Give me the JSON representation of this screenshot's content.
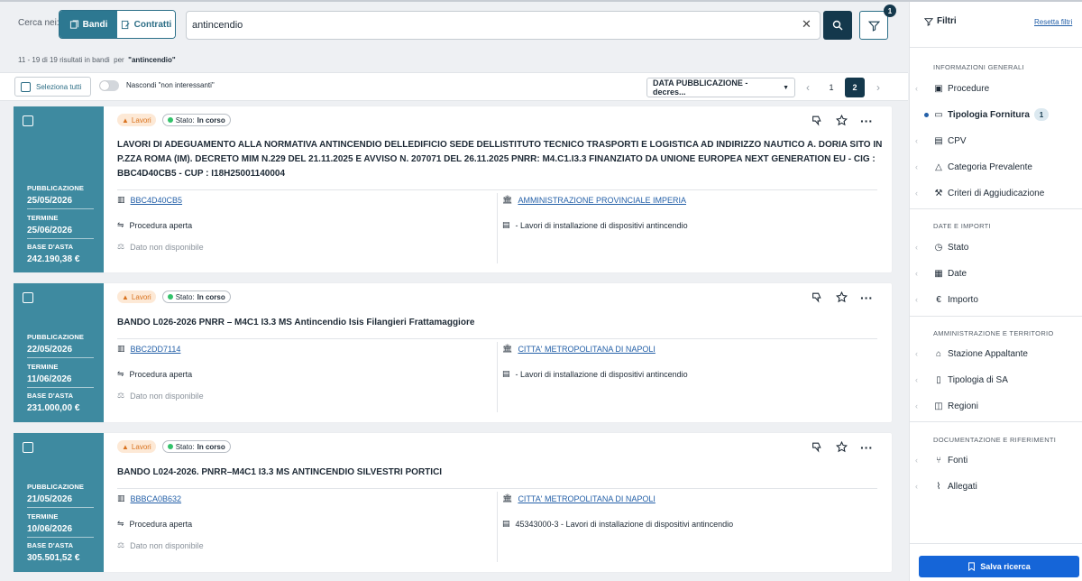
{
  "search": {
    "label": "Cerca nei:",
    "tab_bandi": "Bandi",
    "tab_contratti": "Contratti",
    "query": "antincendio",
    "filter_count": "1"
  },
  "results": {
    "range": "11 - 19 di 19 risultati in bandi",
    "per": "per",
    "query": "\"antincendio\""
  },
  "toolbar": {
    "select_all": "Seleziona tutti",
    "hide_label": "Nascondi \"non interessanti\"",
    "sort_label": "DATA PUBBLICAZIONE - decres...",
    "pages": [
      "1",
      "2"
    ]
  },
  "cards": [
    {
      "labels": {
        "pub": "PUBBLICAZIONE",
        "term": "TERMINE",
        "base": "BASE D'ASTA"
      },
      "pub_date": "25/05/2026",
      "term_date": "25/06/2026",
      "base": "242.190,38 €",
      "chip_type": "Lavori",
      "stato_label": "Stato:",
      "stato_value": "In corso",
      "title": "LAVORI DI ADEGUAMENTO ALLA NORMATIVA ANTINCENDIO DELLEDIFICIO SEDE DELLISTITUTO TECNICO TRASPORTI E LOGISTICA AD INDIRIZZO NAUTICO A. DORIA SITO IN P.ZZA ROMA (IM). DECRETO MIM N.229 DEL 21.11.2025 E AVVISO N. 207071 DEL 26.11.2025 PNRR: M4.C1.I3.3 FINANZIATO DA UNIONE EUROPEA NEXT GENERATION EU - CIG : BBC4D40CB5 - CUP : I18H25001140004",
      "cig": "BBC4D40CB5",
      "procedure": "Procedura aperta",
      "criterio": "Dato non disponibile",
      "ente": "AMMINISTRAZIONE PROVINCIALE IMPERIA",
      "cpv": "- Lavori di installazione di dispositivi antincendio"
    },
    {
      "labels": {
        "pub": "PUBBLICAZIONE",
        "term": "TERMINE",
        "base": "BASE D'ASTA"
      },
      "pub_date": "22/05/2026",
      "term_date": "11/06/2026",
      "base": "231.000,00 €",
      "chip_type": "Lavori",
      "stato_label": "Stato:",
      "stato_value": "In corso",
      "title": "BANDO L026-2026 PNRR – M4C1 I3.3 MS Antincendio Isis Filangieri Frattamaggiore",
      "cig": "BBC2DD7114",
      "procedure": "Procedura aperta",
      "criterio": "Dato non disponibile",
      "ente": "CITTA' METROPOLITANA DI NAPOLI",
      "cpv": "- Lavori di installazione di dispositivi antincendio"
    },
    {
      "labels": {
        "pub": "PUBBLICAZIONE",
        "term": "TERMINE",
        "base": "BASE D'ASTA"
      },
      "pub_date": "21/05/2026",
      "term_date": "10/06/2026",
      "base": "305.501,52 €",
      "chip_type": "Lavori",
      "stato_label": "Stato:",
      "stato_value": "In corso",
      "title": "BANDO L024-2026. PNRR–M4C1 I3.3 MS ANTINCENDIO SILVESTRI PORTICI",
      "cig": "BBBCA0B632",
      "procedure": "Procedura aperta",
      "criterio": "Dato non disponibile",
      "ente": "CITTA' METROPOLITANA DI NAPOLI",
      "cpv": "45343000-3 - Lavori di installazione di dispositivi antincendio"
    }
  ],
  "filters": {
    "title": "Filtri",
    "reset": "Resetta filtri",
    "sections": [
      {
        "title": "INFORMAZIONI GENERALI",
        "items": [
          "Procedure",
          "Tipologia Fornitura",
          "CPV",
          "Categoria Prevalente",
          "Criteri di Aggiudicazione"
        ]
      },
      {
        "title": "DATE E IMPORTI",
        "items": [
          "Stato",
          "Date",
          "Importo"
        ]
      },
      {
        "title": "AMMINISTRAZIONE E TERRITORIO",
        "items": [
          "Stazione Appaltante",
          "Tipologia di SA",
          "Regioni"
        ]
      },
      {
        "title": "DOCUMENTAZIONE E RIFERIMENTI",
        "items": [
          "Fonti",
          "Allegati"
        ]
      }
    ],
    "active_badge": "1",
    "save": "Salva ricerca"
  },
  "colors": {
    "primary": "#14384c",
    "accent": "#3e8aa0",
    "link": "#2460a8",
    "save": "#1565d8"
  }
}
